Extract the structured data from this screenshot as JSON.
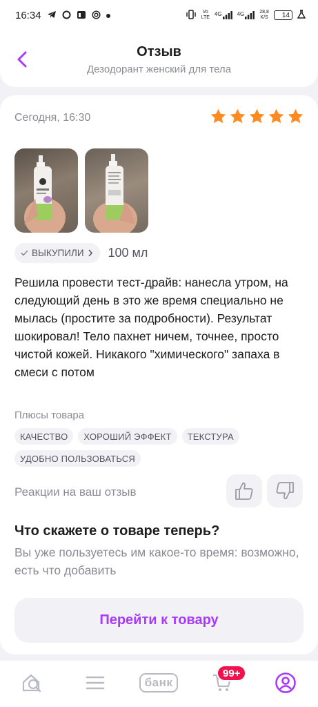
{
  "status_bar": {
    "time": "16:34",
    "network_speed_top": "28,8",
    "network_speed_bottom": "K/S",
    "battery": "14",
    "volte_top": "Vo",
    "volte_bottom": "LTE",
    "net1": "4G",
    "net2": "4G"
  },
  "header": {
    "title": "Отзыв",
    "subtitle": "Дезодорант женский для тела"
  },
  "review": {
    "date": "Сегодня, 16:30",
    "rating": 5,
    "bought_label": "ВЫКУПИЛИ",
    "volume": "100 мл",
    "text": "Решила провести тест-драйв: нанесла утром, на следующий день в это же время специально не мылась (простите за подробности). Результат шокировал! Тело пахнет ничем, точнее, просто чистой кожей. Никакого \"химического\" запаха в смеси с потом",
    "pros_label": "Плюсы товара",
    "pros_tags": [
      "КАЧЕСТВО",
      "ХОРОШИЙ ЭФФЕКТ",
      "ТЕКСТУРА",
      "УДОБНО ПОЛЬЗОВАТЬСЯ"
    ],
    "reactions_label": "Реакции на ваш отзыв"
  },
  "prompt": {
    "title": "Что скажете о товаре теперь?",
    "text": "Вы уже пользуетесь им какое-то время: возможно, есть что добавить",
    "button_label": "Перейти к товару"
  },
  "bottom_nav": {
    "bank_label": "банк",
    "cart_badge": "99+"
  },
  "colors": {
    "accent": "#a73afd",
    "star": "#ff8a1f",
    "badge": "#f0114d"
  },
  "icons": [
    "back-arrow-icon",
    "star-icon",
    "checkmark-icon",
    "chevron-right-icon",
    "thumbs-up-icon",
    "thumbs-down-icon",
    "home-search-icon",
    "menu-icon",
    "cart-icon",
    "profile-icon"
  ]
}
